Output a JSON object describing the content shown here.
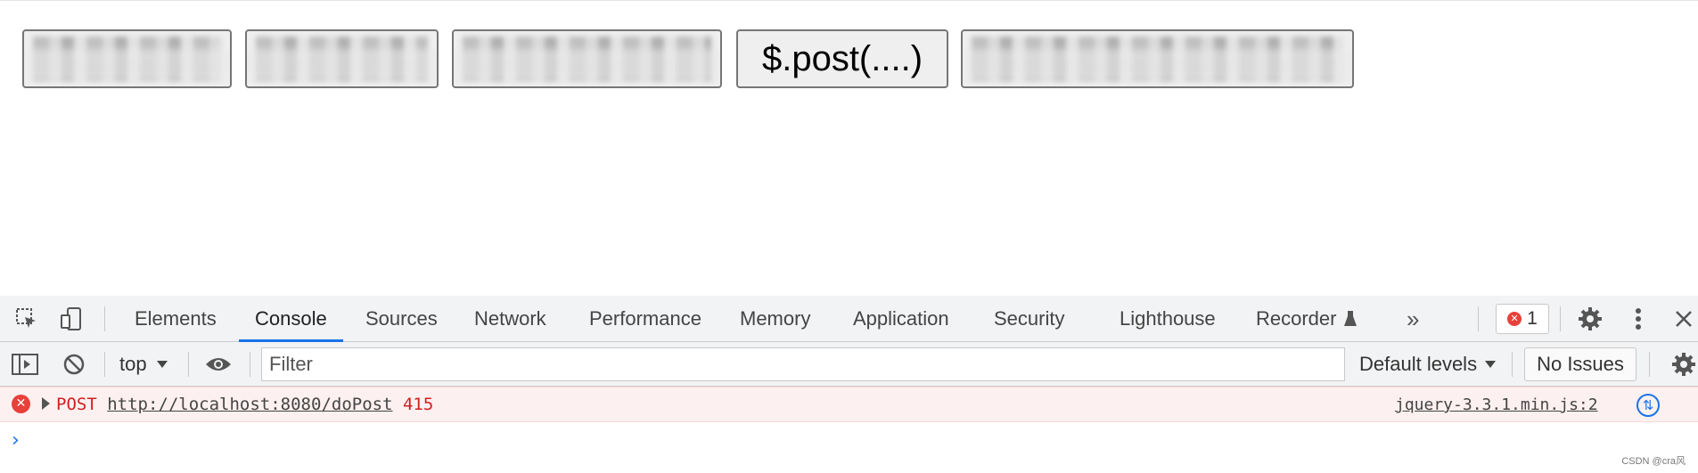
{
  "page": {
    "buttons": [
      {
        "label": ""
      },
      {
        "label": ""
      },
      {
        "label": ""
      },
      {
        "label": "$.post(....)"
      },
      {
        "label": ""
      }
    ]
  },
  "devtools": {
    "tabs": [
      "Elements",
      "Console",
      "Sources",
      "Network",
      "Performance",
      "Memory",
      "Application",
      "Security",
      "Lighthouse",
      "Recorder"
    ],
    "active_tab": "Console",
    "more_tabs_symbol": "»",
    "error_count": "1",
    "toolbar": {
      "context": "top",
      "filter_placeholder": "Filter",
      "levels": "Default levels",
      "issues": "No Issues"
    },
    "messages": [
      {
        "level": "error",
        "method": "POST",
        "url": "http://localhost:8080/doPost",
        "status": "415",
        "source": "jquery-3.3.1.min.js:2"
      }
    ],
    "prompt": "›"
  },
  "watermark": "CSDN @cra风",
  "colors": {
    "accent": "#1a73e8",
    "error": "#d02020",
    "error_bg": "#fdf0f0"
  },
  "icons": [
    "inspect-icon",
    "device-toggle-icon",
    "flask-icon",
    "gear-icon",
    "kebab-menu-icon",
    "close-icon",
    "sidebar-toggle-icon",
    "clear-console-icon",
    "eye-icon",
    "error-icon",
    "network-request-icon"
  ]
}
